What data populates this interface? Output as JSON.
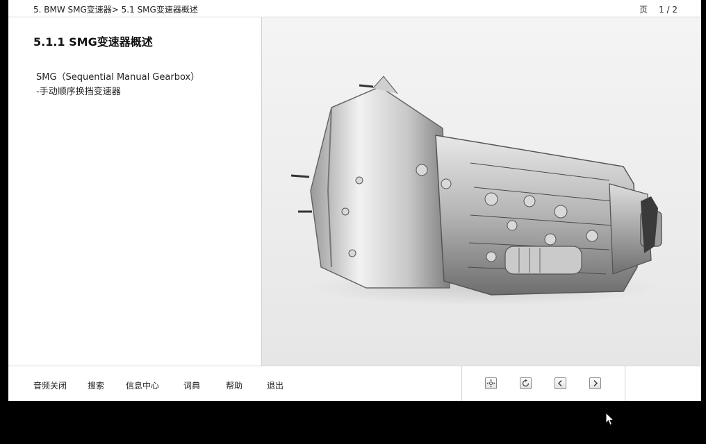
{
  "header": {
    "breadcrumb": "5. BMW SMG变速器> 5.1  SMG变速器概述",
    "page_label": "页",
    "page_value": "1 / 2"
  },
  "content": {
    "title": "5.1.1 SMG变速器概述",
    "line1": "SMG（Sequential Manual Gearbox）",
    "line2": "-手动顺序换挡变速器"
  },
  "footer": {
    "menu": [
      "音频关闭",
      "搜索",
      "信息中心",
      "词典",
      "帮助",
      "退出"
    ],
    "nav_icons": [
      "home-icon",
      "refresh-icon",
      "prev-icon",
      "next-icon"
    ]
  }
}
